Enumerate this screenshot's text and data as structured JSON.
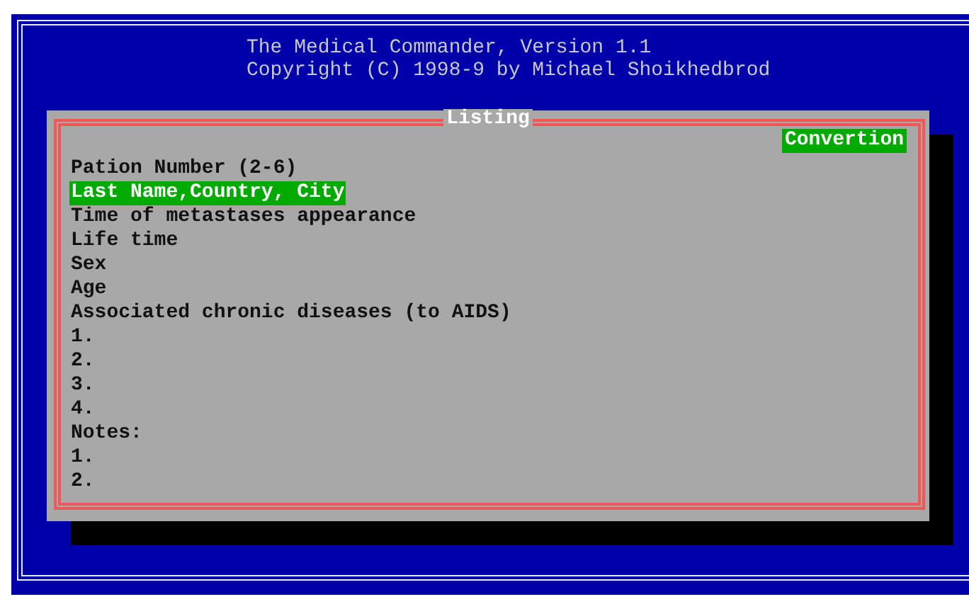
{
  "header": {
    "title": "The Medical Commander, Version 1.1",
    "copyright": "Copyright (C) 1998-9 by Michael Shoikhedbrod"
  },
  "dialog": {
    "title": "Listing",
    "button": "Convertion",
    "items": [
      {
        "label": "Pation Number (2-6)",
        "selected": false
      },
      {
        "label": "Last Name,Country, City",
        "selected": true
      },
      {
        "label": "Time of metastases appearance",
        "selected": false
      },
      {
        "label": "Life time",
        "selected": false
      },
      {
        "label": "Sex",
        "selected": false
      },
      {
        "label": "Age",
        "selected": false
      },
      {
        "label": "Associated chronic diseases (to AIDS)",
        "selected": false
      },
      {
        "label": "1.",
        "selected": false
      },
      {
        "label": "2.",
        "selected": false
      },
      {
        "label": "3.",
        "selected": false
      },
      {
        "label": "4.",
        "selected": false
      },
      {
        "label": "Notes:",
        "selected": false
      },
      {
        "label": "1.",
        "selected": false
      },
      {
        "label": "2.",
        "selected": false
      }
    ]
  }
}
